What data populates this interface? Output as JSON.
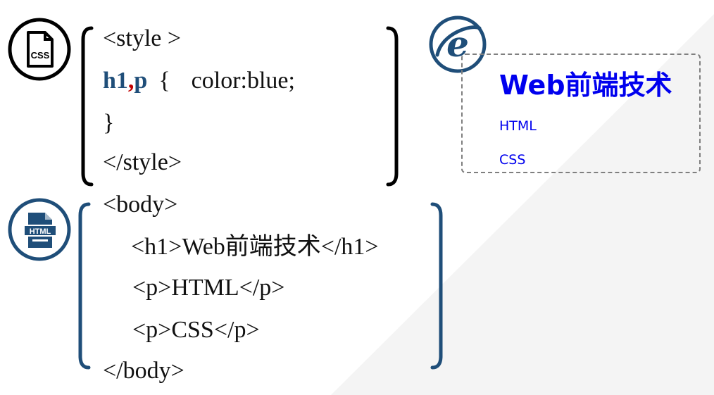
{
  "css_block": {
    "line1": "<style >",
    "selector_h1": "h1",
    "comma": ",",
    "selector_p": "p",
    "brace_open": "{",
    "declaration": "color:blue;",
    "brace_close": "}",
    "line4": "</style>"
  },
  "html_block": {
    "line1": "<body>",
    "line2": "<h1>Web前端技术</h1>",
    "line3": "<p>HTML</p>",
    "line4": "<p>CSS</p>",
    "line5": "</body>"
  },
  "preview": {
    "heading": "Web前端技术",
    "para1": "HTML",
    "para2": "CSS"
  },
  "icons": {
    "css_badge": "CSS",
    "html_badge": "HTML",
    "browser": "e"
  },
  "colors": {
    "dark_blue": "#1f4e79",
    "preview_blue": "#0000ee",
    "comma_red": "#c00000"
  }
}
